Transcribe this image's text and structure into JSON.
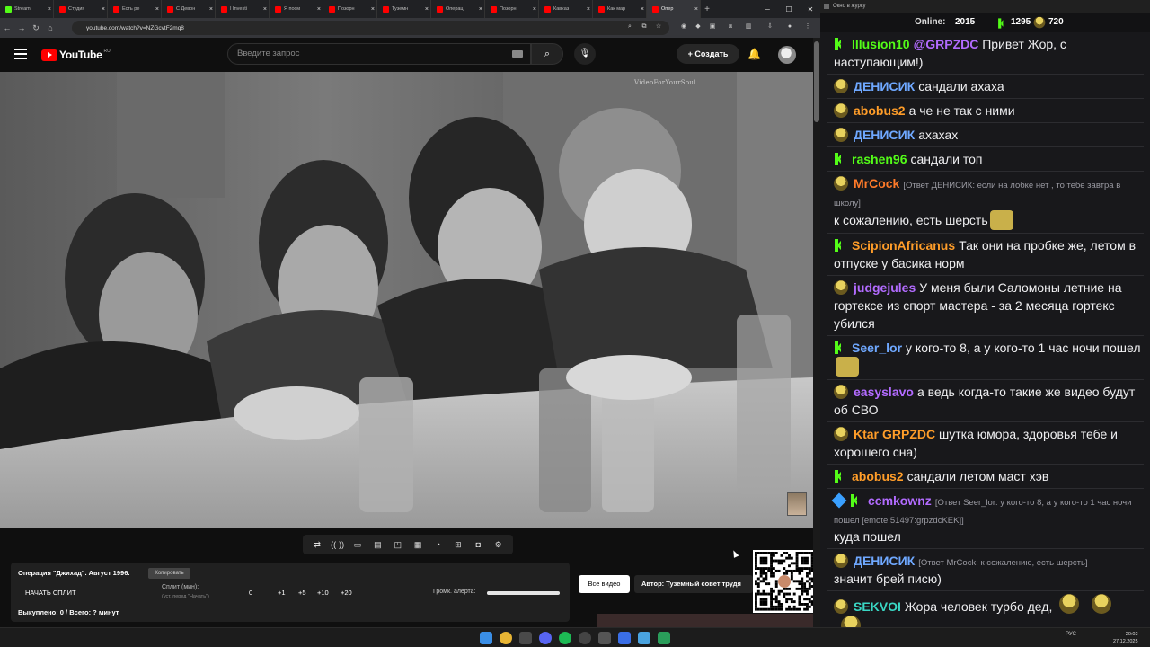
{
  "browser": {
    "tabs": [
      {
        "label": "Stream",
        "color": "#53fc18"
      },
      {
        "label": "Студия",
        "color": "#ff0000"
      },
      {
        "label": "Есть ре",
        "color": "#ff0000"
      },
      {
        "label": "С Девон",
        "color": "#ff0000"
      },
      {
        "label": "I Investi",
        "color": "#ff0000"
      },
      {
        "label": "Я посм",
        "color": "#ff0000"
      },
      {
        "label": "Позорн",
        "color": "#ff0000"
      },
      {
        "label": "Туземн",
        "color": "#ff0000"
      },
      {
        "label": "Операц",
        "color": "#ff0000"
      },
      {
        "label": "Позорн",
        "color": "#ff0000"
      },
      {
        "label": "Кавказ",
        "color": "#ff0000"
      },
      {
        "label": "Как мар",
        "color": "#ff0000"
      },
      {
        "label": "Опер",
        "color": "#ff0000",
        "active": true
      }
    ],
    "close_glyph": "×",
    "new_tab_glyph": "+",
    "url": "youtube.com/watch?v=NZGcvtF2mq8"
  },
  "youtube": {
    "logo_text": "YouTube",
    "region": "RU",
    "search_placeholder": "Введите запрос",
    "create_label": "Создать"
  },
  "video": {
    "watermark": "VideoForYourSoul"
  },
  "panel": {
    "title": "Операция \"Джихад\". Август 1996.",
    "copy_label": "Копировать",
    "start_split_label": "НАЧАТЬ СПЛИТ",
    "split_label": "Сплит (мин):",
    "split_hint": "(уст. перед \"Начать\")",
    "split_value": "0",
    "steps": [
      "+1",
      "+5",
      "+10",
      "+20"
    ],
    "alert_label": "Громк. алерта:",
    "alert_level": 1.0,
    "paid_line": "Выкуплено: 0 / Всего: ? минут",
    "all_video_label": "Все видео",
    "author_label": "Автор: Туземный совет трудя"
  },
  "chat": {
    "window_title": "Окно в журку",
    "online_label": "Online:",
    "online_count": "2015",
    "kick_count": "1295",
    "other_count": "720",
    "messages": [
      {
        "badge": "kick",
        "user": "Illusion10",
        "color": "#53fc18",
        "text": "@GRPZDC Привет Жор, с наступающим!)",
        "mention": "@GRPZDC",
        "body": " Привет Жор, с наступающим!)"
      },
      {
        "badge": "bd",
        "user": "ДЕНИСИК",
        "color": "#6fa8ff",
        "text": "сандали ахаха"
      },
      {
        "badge": "bd",
        "user": "abobus2",
        "color": "#ff9d29",
        "text": "а че не так с ними"
      },
      {
        "badge": "bd",
        "user": "ДЕНИСИК",
        "color": "#6fa8ff",
        "text": "ахахах"
      },
      {
        "badge": "kick",
        "user": "rashen96",
        "color": "#53fc18",
        "text": "сандали топ"
      },
      {
        "badge": "bd",
        "user": "MrCock",
        "color": "#ff7a29",
        "reply": "[Ответ ДЕНИСИК: если на лобке нет , то тебе завтра в школу]",
        "text": "к сожалению, есть шерсть",
        "emote": true
      },
      {
        "badge": "kick",
        "user": "ScipionAfricanus",
        "color": "#ff9d29",
        "text": "Так они на пробке же, летом в отпуске у басика норм"
      },
      {
        "badge": "bd",
        "user": "judgejules",
        "color": "#b26bff",
        "text": "У меня были Саломоны летние на гортексе из спорт мастера - за 2 месяца гортекс убился"
      },
      {
        "badge": "kick",
        "user": "Seer_lor",
        "color": "#6fa8ff",
        "text": "у кого-то 8, а у кого-то 1 час ночи пошел",
        "emote": true
      },
      {
        "badge": "bd",
        "user": "easyslavo",
        "color": "#b26bff",
        "text": "а ведь когда-то такие же видео будут об СВО"
      },
      {
        "badge": "bd",
        "user": "Ktar",
        "color": "#ff9d29",
        "text": "GRPZDC шутка юмора, здоровья тебе и хорошего сна)",
        "mention": "GRPZDC",
        "body": " шутка юмора, здоровья тебе и хорошего сна)"
      },
      {
        "badge": "kick",
        "user": "abobus2",
        "color": "#ff9d29",
        "text": "сандали летом маст хэв"
      },
      {
        "badge": "sw-kick",
        "user": "ccmkownz",
        "color": "#b26bff",
        "reply": "[Ответ Seer_lor: у кого-то 8, а у кого-то 1 час ночи пошел [emote:51497:grpzdcKEK]]",
        "text": "куда пошел"
      },
      {
        "badge": "bd",
        "user": "ДЕНИСИК",
        "color": "#6fa8ff",
        "reply": "[Ответ MrCock: к сожалению, есть шерсть]",
        "text": "значит брей писю)"
      },
      {
        "badge": "bd",
        "user": "SEKVOI",
        "color": "#3ad7c4",
        "text": "Жора человек турбо дед,",
        "emote3": true
      }
    ]
  },
  "taskbar": {
    "lang": "РУС",
    "time": "20:02",
    "date": "27.12.2025"
  }
}
